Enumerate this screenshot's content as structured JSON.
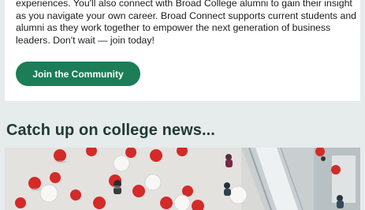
{
  "community": {
    "intro_text": "experiences. You'll also connect with Broad College alumni to gain their insight as you navigate your own career. Broad Connect supports current students and alumni as they work together to empower the next generation of business leaders. Don't wait — join today!",
    "join_button_label": "Join the Community",
    "button_color": "#1b7e57"
  },
  "news": {
    "heading": "Catch up on college news...",
    "photo_icon": "atrium-photo"
  },
  "colors": {
    "page_background": "#e6ebeb",
    "heading_color": "#1f3a33"
  }
}
